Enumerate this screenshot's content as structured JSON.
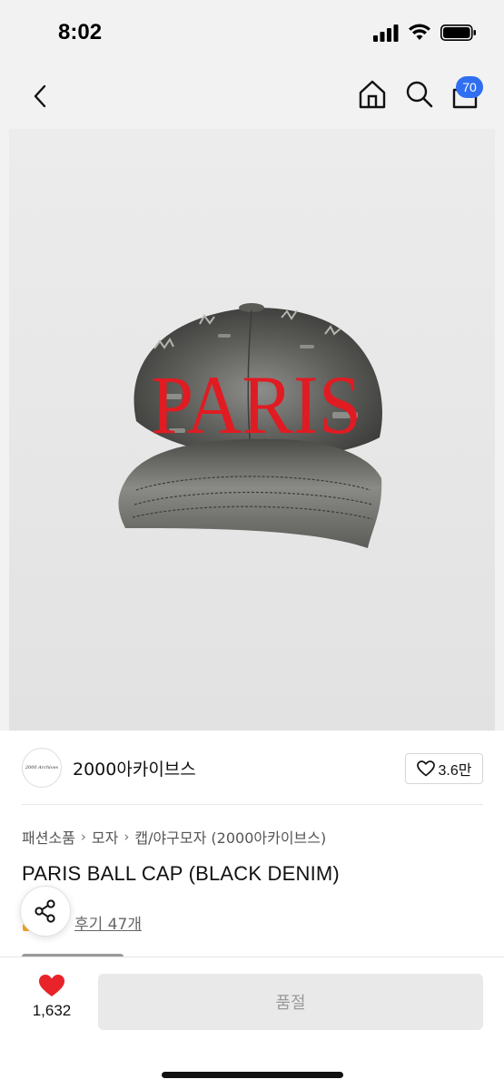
{
  "status": {
    "time": "8:02"
  },
  "nav": {
    "cart_count": "70"
  },
  "product_image": {
    "cap_text": "PARIS"
  },
  "brand": {
    "logo_text": "2000 Archives",
    "name": "2000아카이브스",
    "likes": "3.6만"
  },
  "breadcrumb": [
    "패션소품",
    "모자",
    "캡/야구모자 (2000아카이브스)"
  ],
  "product": {
    "title": "PARIS BALL CAP (BLACK DENIM)",
    "reviews": "후기 47개"
  },
  "bottom": {
    "wish_count": "1,632",
    "purchase_label": "품절"
  },
  "colors": {
    "accent": "#2f6ff0",
    "heart": "#e8232a",
    "cap_text": "#e11b22"
  }
}
